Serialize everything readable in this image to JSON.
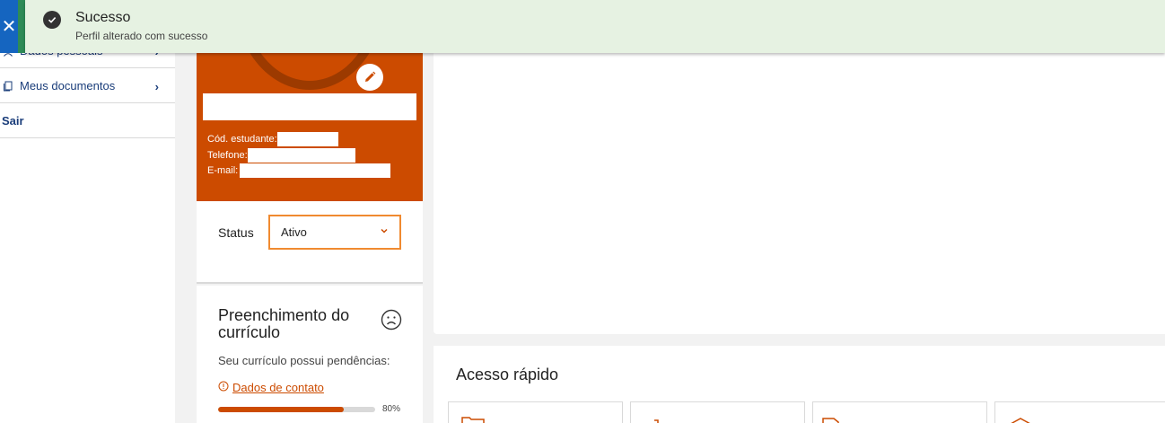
{
  "toast": {
    "title": "Sucesso",
    "message": "Perfil alterado com sucesso",
    "close_glyph": "✕",
    "check_icon": "check-circle-icon",
    "accent_color": "#2e8b57",
    "close_bg": "#1565c0"
  },
  "sidebar": {
    "items": [
      {
        "label": "Dados pessoais",
        "icon": "person-icon"
      },
      {
        "label": "Meus documentos",
        "icon": "documents-icon"
      },
      {
        "label": "Sair"
      }
    ]
  },
  "profile": {
    "code_label": "Cód. estudante:",
    "phone_label": "Telefone:",
    "email_label": "E-mail:",
    "edit_icon": "pencil-icon",
    "brand_color": "#cc4b00"
  },
  "status": {
    "label": "Status",
    "value": "Ativo"
  },
  "curriculum": {
    "title": "Preenchimento do currículo",
    "subtitle": "Seu currículo possui pendências:",
    "pending_link": "Dados de contato",
    "progress_fraction": 0.8,
    "progress_label": "80%",
    "mood_icon": "sad-face-icon"
  },
  "quick_access": {
    "title": "Acesso rápido",
    "tiles": [
      {
        "icon": "folder-icon"
      },
      {
        "icon": "network-icon"
      },
      {
        "icon": "document-icon"
      },
      {
        "icon": "graduation-cap-icon"
      }
    ]
  }
}
